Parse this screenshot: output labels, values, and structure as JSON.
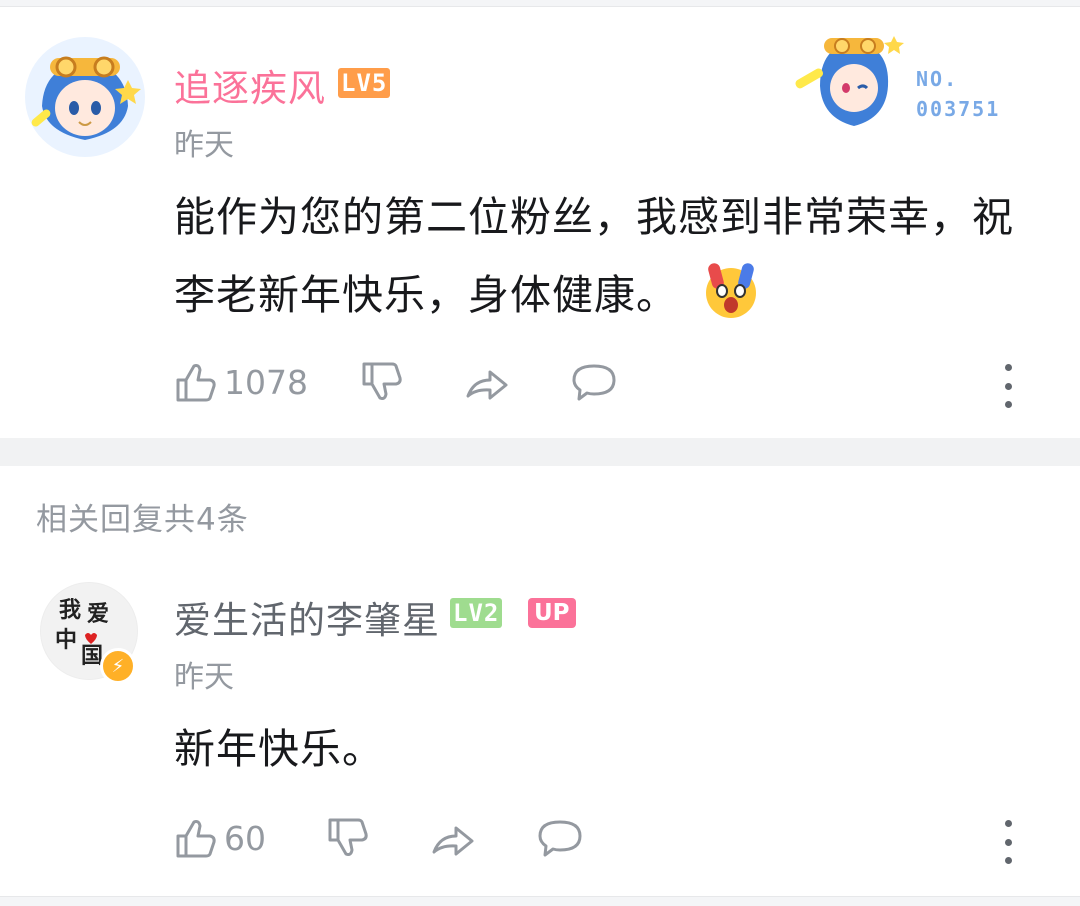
{
  "main_comment": {
    "username": "追逐疾风",
    "level": "LV5",
    "time": "昨天",
    "content_line1": "能作为您的第二位粉丝，我感到非常荣幸，祝",
    "content_line2": "李老新年快乐，身体健康。",
    "likes": "1078",
    "fan_badge_no_label": "NO.",
    "fan_badge_no_value": "003751",
    "colors": {
      "username": "#fb7299",
      "level_badge": "#ff9d4a"
    }
  },
  "replies_header": "相关回复共4条",
  "reply_comment": {
    "username": "爱生活的李肇星",
    "level": "LV2",
    "up_tag": "UP",
    "time": "昨天",
    "content": "新年快乐。",
    "likes": "60",
    "avatar_text": [
      "我",
      "爱",
      "中",
      "国"
    ],
    "colors": {
      "level_badge": "#9fdc8f",
      "up_tag": "#fb7299",
      "verified": "#ffb027"
    }
  },
  "icons": {
    "like": "thumb-up-icon",
    "dislike": "thumb-down-icon",
    "share": "share-icon",
    "reply": "comment-icon",
    "more": "more-vertical-icon"
  }
}
